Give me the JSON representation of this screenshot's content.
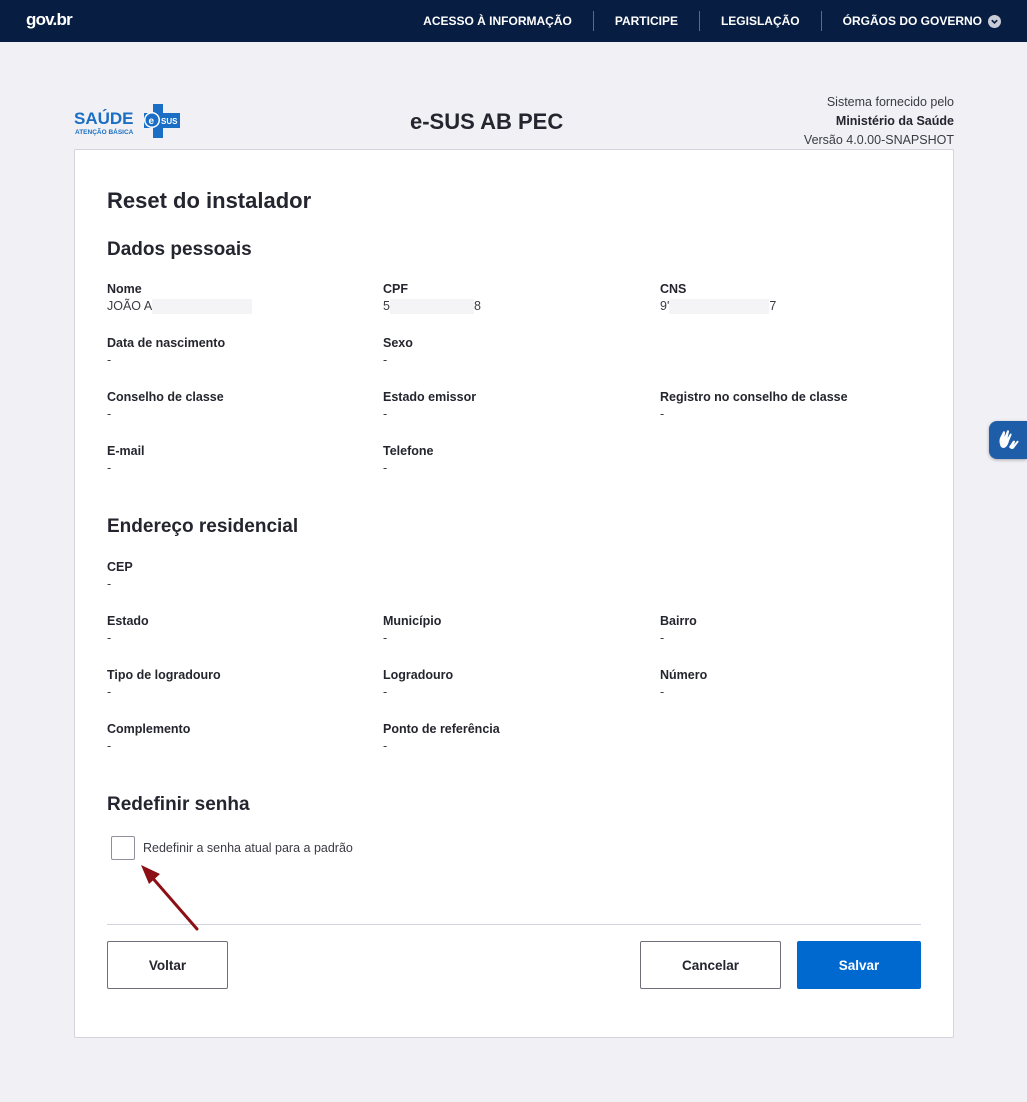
{
  "topbar": {
    "logo": "gov.br",
    "nav": [
      {
        "label": "ACESSO À INFORMAÇÃO"
      },
      {
        "label": "PARTICIPE"
      },
      {
        "label": "LEGISLAÇÃO"
      },
      {
        "label": "ÓRGÃOS DO GOVERNO"
      }
    ]
  },
  "header": {
    "brand_main": "SAÚDE",
    "brand_sub": "ATENÇÃO BÁSICA",
    "brand_badge": "SUS",
    "brand_e": "e",
    "app_title": "e-SUS AB PEC",
    "supplier_line1": "Sistema fornecido pelo",
    "supplier_line2": "Ministério da Saúde",
    "supplier_line3": "Versão 4.0.00-SNAPSHOT"
  },
  "page": {
    "title": "Reset do instalador"
  },
  "dados_pessoais": {
    "title": "Dados pessoais",
    "nome": {
      "label": "Nome",
      "value": "JOÃO A"
    },
    "cpf": {
      "label": "CPF",
      "value_start": "5",
      "value_end": "8"
    },
    "cns": {
      "label": "CNS",
      "value_start": "9'",
      "value_end": "7"
    },
    "nascimento": {
      "label": "Data de nascimento",
      "value": "-"
    },
    "sexo": {
      "label": "Sexo",
      "value": "-"
    },
    "conselho": {
      "label": "Conselho de classe",
      "value": "-"
    },
    "estado_emissor": {
      "label": "Estado emissor",
      "value": "-"
    },
    "registro": {
      "label": "Registro no conselho de classe",
      "value": "-"
    },
    "email": {
      "label": "E-mail",
      "value": "-"
    },
    "telefone": {
      "label": "Telefone",
      "value": "-"
    }
  },
  "endereco": {
    "title": "Endereço residencial",
    "cep": {
      "label": "CEP",
      "value": "-"
    },
    "estado": {
      "label": "Estado",
      "value": "-"
    },
    "municipio": {
      "label": "Município",
      "value": "-"
    },
    "bairro": {
      "label": "Bairro",
      "value": "-"
    },
    "tipo_logradouro": {
      "label": "Tipo de logradouro",
      "value": "-"
    },
    "logradouro": {
      "label": "Logradouro",
      "value": "-"
    },
    "numero": {
      "label": "Número",
      "value": "-"
    },
    "complemento": {
      "label": "Complemento",
      "value": "-"
    },
    "referencia": {
      "label": "Ponto de referência",
      "value": "-"
    }
  },
  "senha": {
    "title": "Redefinir senha",
    "checkbox_label": "Redefinir a senha atual para a padrão",
    "checked": false
  },
  "actions": {
    "voltar": "Voltar",
    "cancelar": "Cancelar",
    "salvar": "Salvar"
  },
  "colors": {
    "topbar": "#071d41",
    "primary": "#0069d0",
    "arrow": "#8b0f14"
  },
  "icons": {
    "dropdown": "chevron-down-icon",
    "accessibility": "vlibras-hands-icon",
    "annotation": "arrow-icon"
  }
}
